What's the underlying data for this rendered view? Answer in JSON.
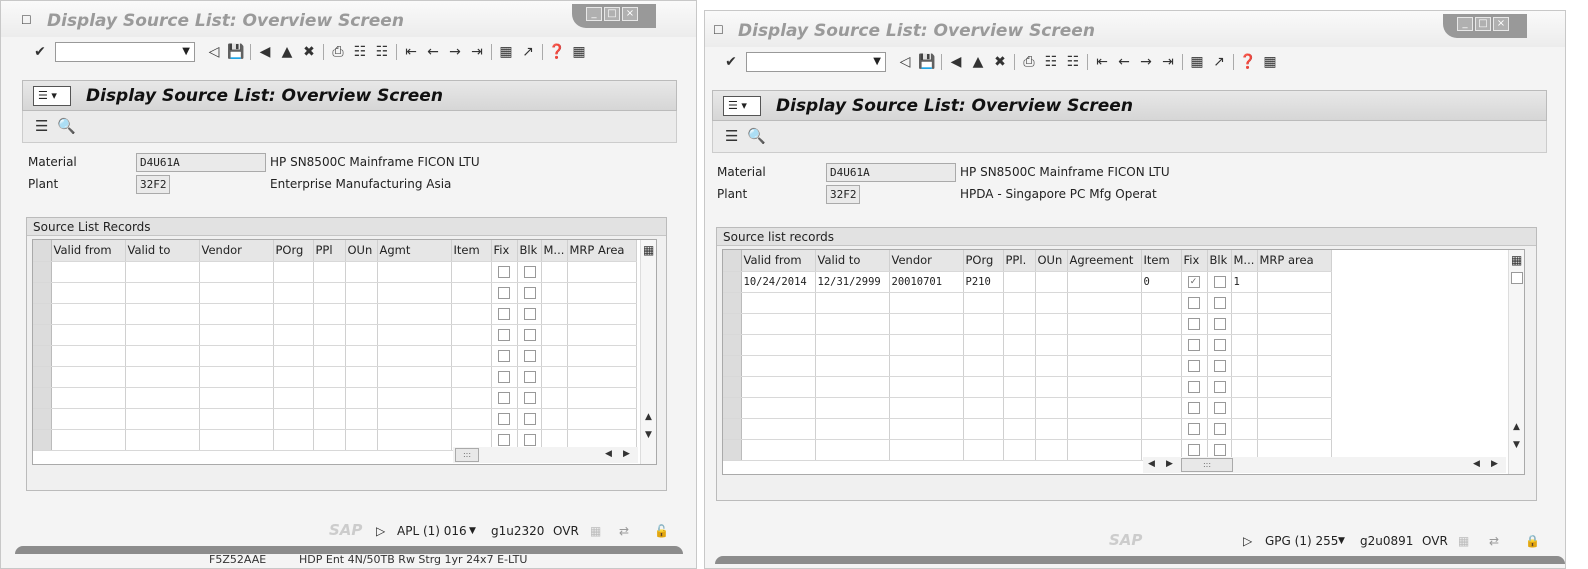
{
  "left": {
    "window_title": "Display Source List: Overview Screen",
    "screen_title": "Display Source List: Overview Screen",
    "material_label": "Material",
    "material_value": "D4U61A",
    "material_desc": "HP SN8500C Mainframe FICON LTU",
    "plant_label": "Plant",
    "plant_value": "32F2",
    "plant_desc": "Enterprise Manufacturing Asia",
    "group_title": "Source List Records",
    "columns": [
      "Valid from",
      "Valid to",
      "Vendor",
      "POrg",
      "PPl",
      "OUn",
      "Agmt",
      "Item",
      "Fix",
      "Blk",
      "M...",
      "MRP Area"
    ],
    "status": {
      "system": "APL (1) 016",
      "server": "g1u2320",
      "mode": "OVR"
    },
    "below_text_1": "F5Z52AAE",
    "below_text_2": "HDP Ent 4N/50TB Rw Strg 1yr 24x7 E-LTU"
  },
  "right": {
    "window_title": "Display Source List: Overview Screen",
    "screen_title": "Display Source List: Overview Screen",
    "material_label": "Material",
    "material_value": "D4U61A",
    "material_desc": "HP SN8500C Mainframe FICON LTU",
    "plant_label": "Plant",
    "plant_value": "32F2",
    "plant_desc": "HPDA - Singapore PC Mfg Operat",
    "group_title": "Source list records",
    "columns": [
      "Valid from",
      "Valid to",
      "Vendor",
      "POrg",
      "PPl.",
      "OUn",
      "Agreement",
      "Item",
      "Fix",
      "Blk",
      "M...",
      "MRP area"
    ],
    "row1": {
      "valid_from": "10/24/2014",
      "valid_to": "12/31/2999",
      "vendor": "20010701",
      "porg": "P210",
      "item": "0",
      "fix": true,
      "blk": false,
      "m": "1"
    },
    "status": {
      "system": "GPG (1) 255",
      "server": "g2u0891",
      "mode": "OVR"
    }
  },
  "sap_logo": "SAP",
  "colors": {
    "window_bg": "#f4f4f4",
    "header_bg": "#dddddd",
    "title_grey": "#9a9a9a"
  }
}
